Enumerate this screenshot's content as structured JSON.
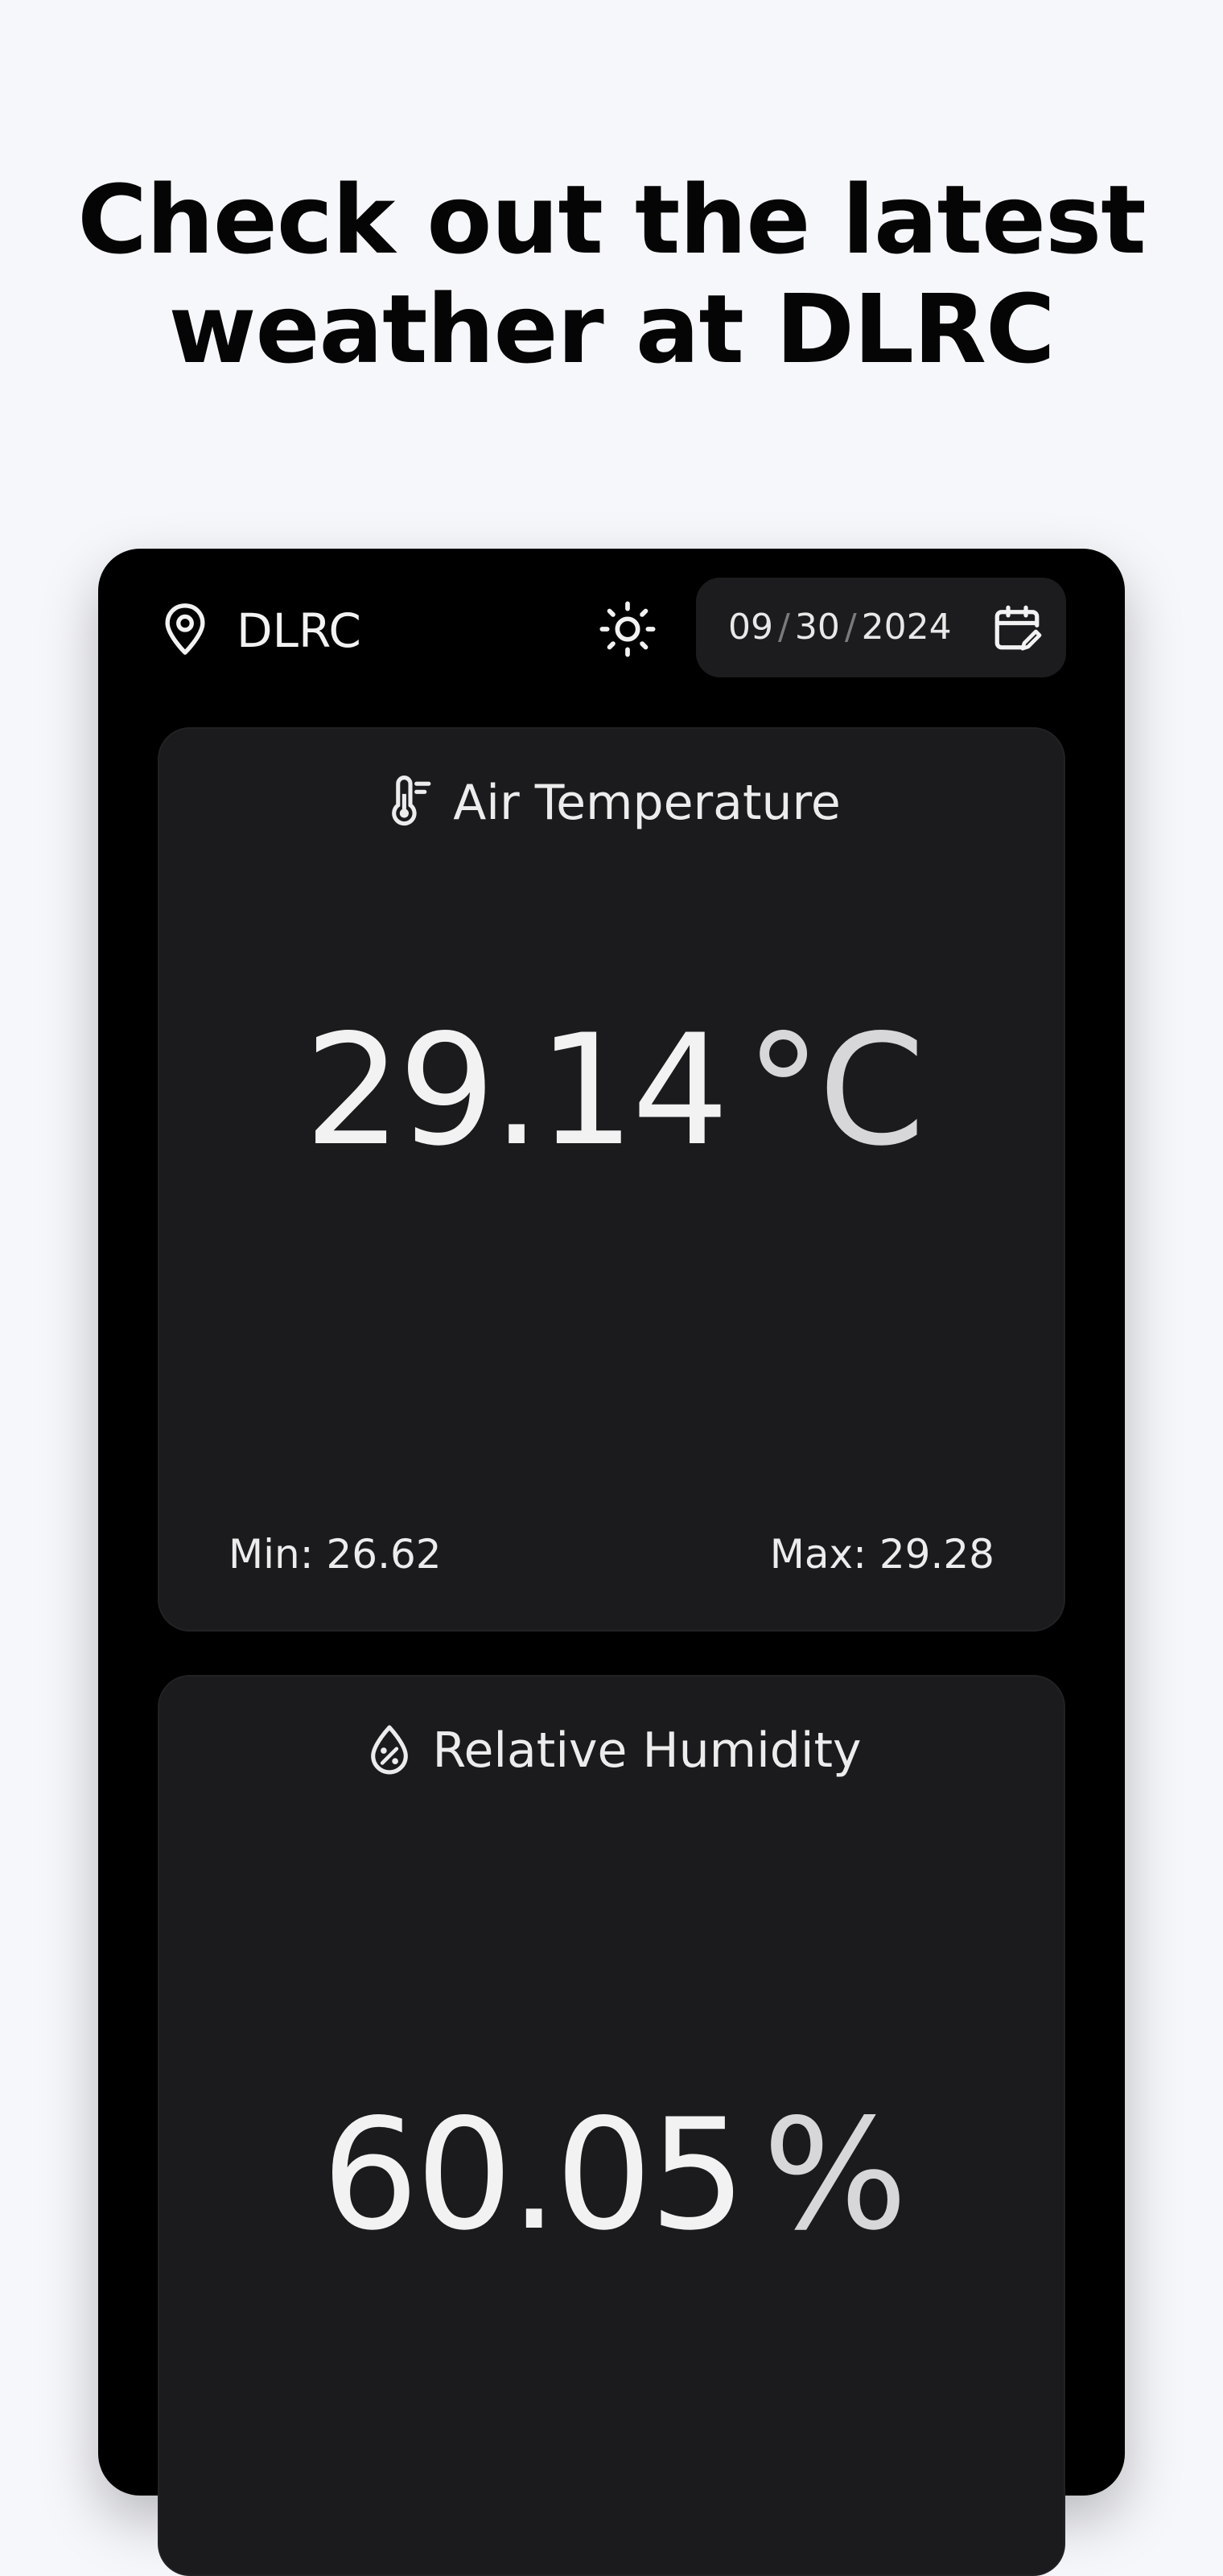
{
  "headline": {
    "line1": "Check out the latest",
    "line2": "weather at DLRC"
  },
  "topbar": {
    "location_icon": "map-pin-icon",
    "location": "DLRC",
    "theme_toggle_icon": "sun-icon",
    "date": {
      "month": "09",
      "day": "30",
      "year": "2024",
      "separator": "/",
      "icon": "calendar-edit-icon"
    }
  },
  "air_temperature": {
    "icon": "thermometer-icon",
    "title": "Air Temperature",
    "value": "29.14",
    "unit": "°C",
    "min_label": "Min: 26.62",
    "max_label": "Max: 29.28"
  },
  "humidity": {
    "icon": "humidity-drop-icon",
    "title": "Relative Humidity",
    "value": "60.05",
    "unit": "%"
  },
  "colors": {
    "page_background": "#f6f7fb",
    "device_background": "#000000",
    "card_background": "#1b1b1d",
    "text_primary": "#f2f2f2"
  }
}
